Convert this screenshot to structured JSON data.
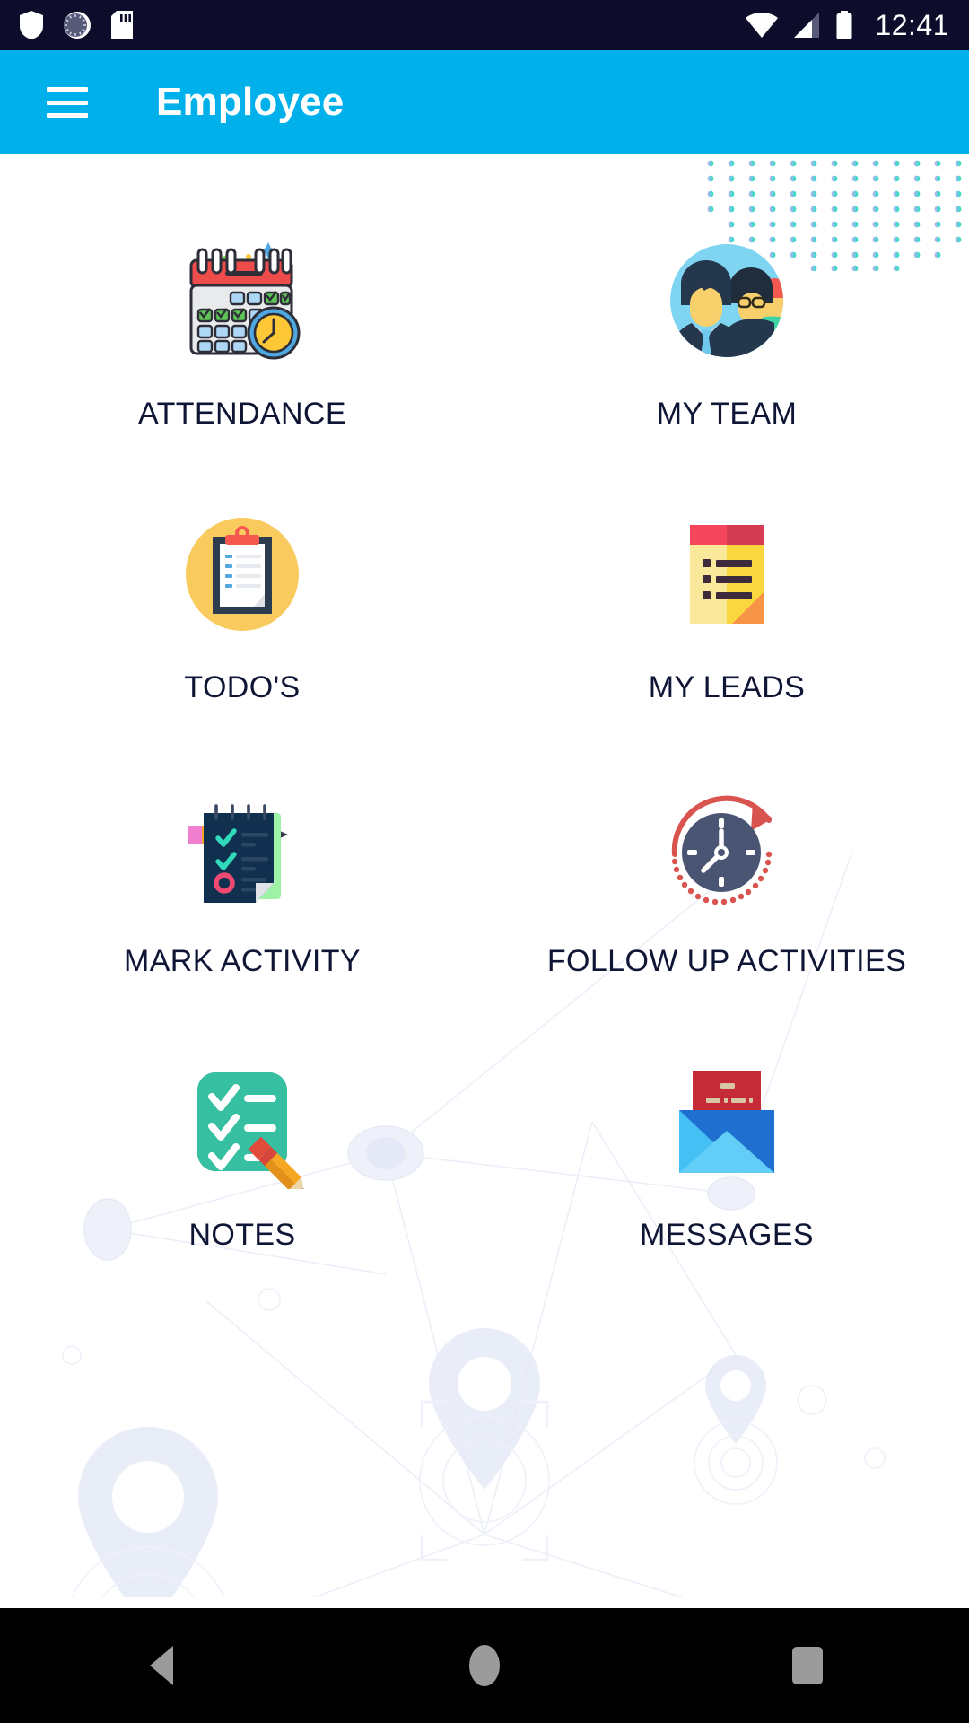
{
  "status_bar": {
    "time": "12:41",
    "icons_left": [
      "shield-icon",
      "sync-spinner-icon",
      "sd-card-icon"
    ],
    "icons_right": [
      "wifi-icon",
      "cellular-signal-icon",
      "battery-icon"
    ],
    "background_color": "#0d0d2b"
  },
  "app_bar": {
    "title": "Employee",
    "menu_icon": "hamburger-menu-icon",
    "background_color": "#00b0ea",
    "text_color": "#ffffff"
  },
  "grid": {
    "items": [
      {
        "label": "ATTENDANCE",
        "icon": "calendar-clock-icon"
      },
      {
        "label": "MY TEAM",
        "icon": "team-people-icon"
      },
      {
        "label": "TODO'S",
        "icon": "clipboard-icon"
      },
      {
        "label": "MY LEADS",
        "icon": "notepad-list-icon"
      },
      {
        "label": "MARK ACTIVITY",
        "icon": "notebook-pencil-icon"
      },
      {
        "label": "FOLLOW UP ACTIVITIES",
        "icon": "clock-arrow-icon"
      },
      {
        "label": "NOTES",
        "icon": "checklist-pencil-icon"
      },
      {
        "label": "MESSAGES",
        "icon": "envelope-letter-icon"
      }
    ],
    "label_color": "#0f1535"
  },
  "nav_bar": {
    "buttons": [
      {
        "name": "back",
        "icon": "triangle-back-icon"
      },
      {
        "name": "home",
        "icon": "circle-home-icon"
      },
      {
        "name": "recents",
        "icon": "square-recents-icon"
      }
    ],
    "background_color": "#000000",
    "icon_color": "#9b9b9b"
  },
  "decorations": {
    "dot_grid": {
      "colors": [
        "#b9aee8",
        "#7fc6e8",
        "#3fd9c8",
        "#2ee0b0"
      ]
    },
    "network_watermark_color": "#e8ecf7"
  }
}
